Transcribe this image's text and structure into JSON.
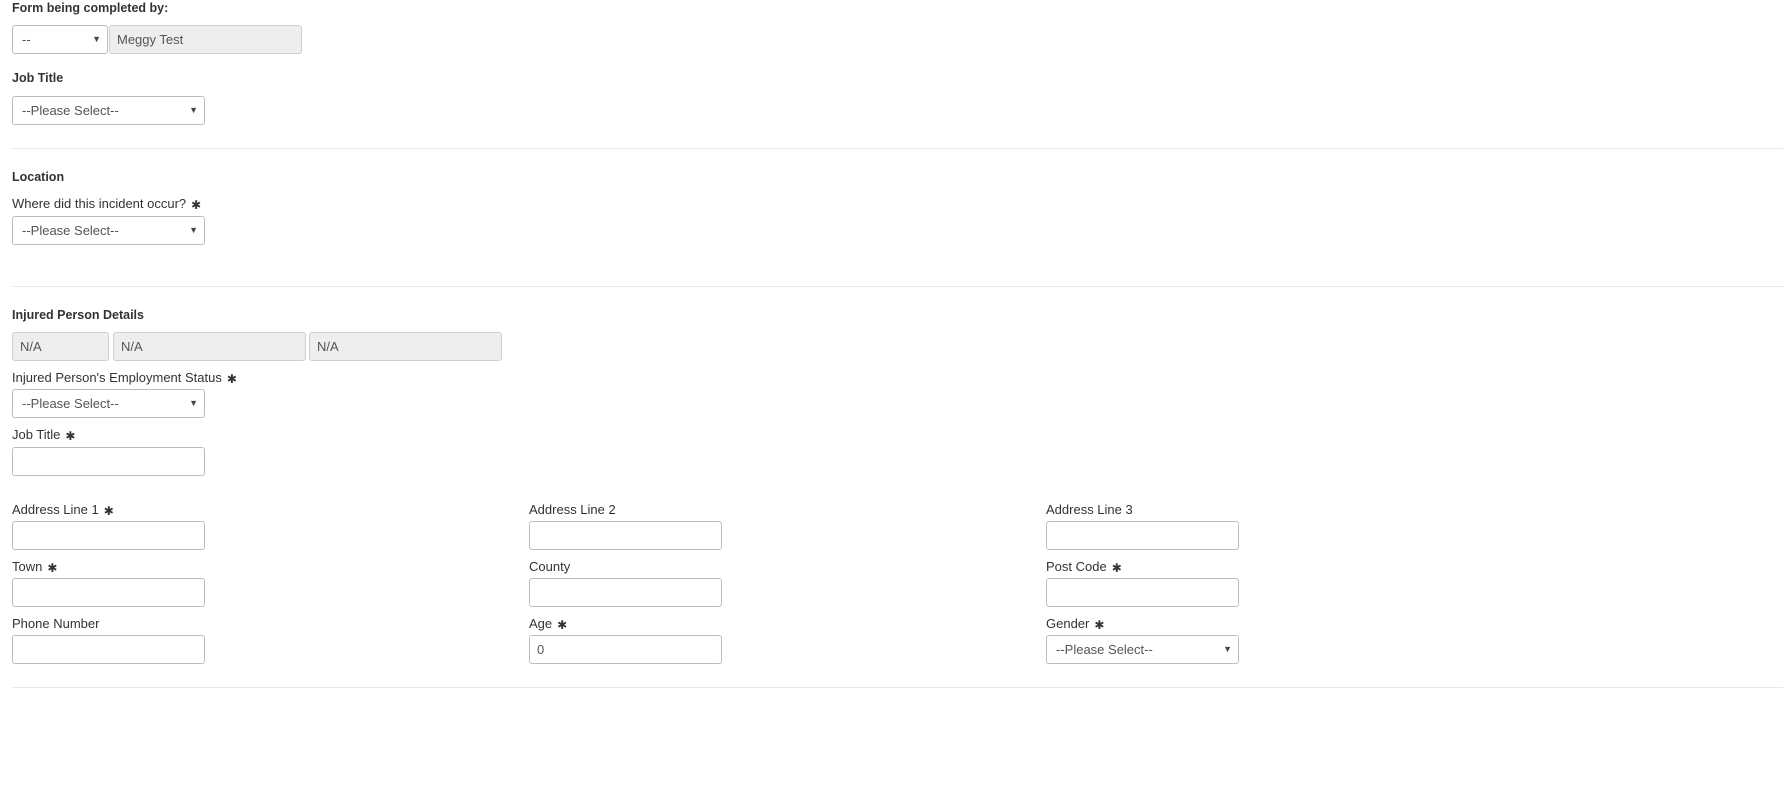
{
  "form_completed_by": {
    "heading": "Form being completed by:",
    "title_select": "--",
    "name_value": "Meggy  Test"
  },
  "job_title_section": {
    "heading": "Job Title",
    "select_value": "--Please Select--"
  },
  "location_section": {
    "heading": "Location",
    "question": "Where did this incident occur?",
    "select_value": "--Please Select--"
  },
  "injured_person": {
    "heading": "Injured Person Details",
    "name_fields": [
      "N/A",
      "N/A",
      "N/A"
    ],
    "employment_status_label": "Injured Person's Employment Status",
    "employment_status_value": "--Please Select--",
    "job_title_label": "Job Title",
    "job_title_value": "",
    "address_line1_label": "Address Line 1",
    "address_line1_value": "",
    "address_line2_label": "Address Line 2",
    "address_line2_value": "",
    "address_line3_label": "Address Line 3",
    "address_line3_value": "",
    "town_label": "Town",
    "town_value": "",
    "county_label": "County",
    "county_value": "",
    "post_code_label": "Post Code",
    "post_code_value": "",
    "phone_label": "Phone Number",
    "phone_value": "",
    "age_label": "Age",
    "age_value": "0",
    "gender_label": "Gender",
    "gender_value": "--Please Select--"
  },
  "icons": {
    "required": "required-asterisk-icon",
    "dropdown": "caret-down-icon"
  },
  "glyphs": {
    "required": "✱",
    "caret": "▼"
  },
  "colors": {
    "text": "#333333",
    "input_border": "#bdbdbd",
    "readonly_bg": "#eeeeee",
    "divider": "#e8e8e8"
  }
}
